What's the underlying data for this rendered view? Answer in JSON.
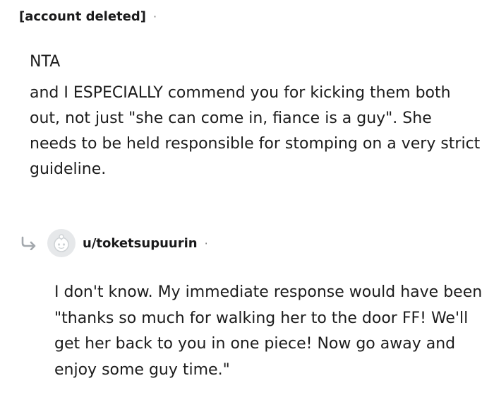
{
  "comment": {
    "author": "[account deleted]",
    "separator": "·",
    "verdict": "NTA",
    "text": "and I ESPECIALLY commend you for kicking them both out, not just \"she can come in, fiance is a guy\". She needs to be held responsible for stomping on a very strict guideline."
  },
  "reply": {
    "reply_icon": "reply-arrow-icon",
    "avatar_icon": "snoo-avatar-icon",
    "author": "u/toketsupuurin",
    "separator": "·",
    "text": "I don't know. My immediate response would have been \"thanks so much for walking her to the door FF! We'll get her back to you in one piece! Now go away and enjoy some guy time.\""
  }
}
